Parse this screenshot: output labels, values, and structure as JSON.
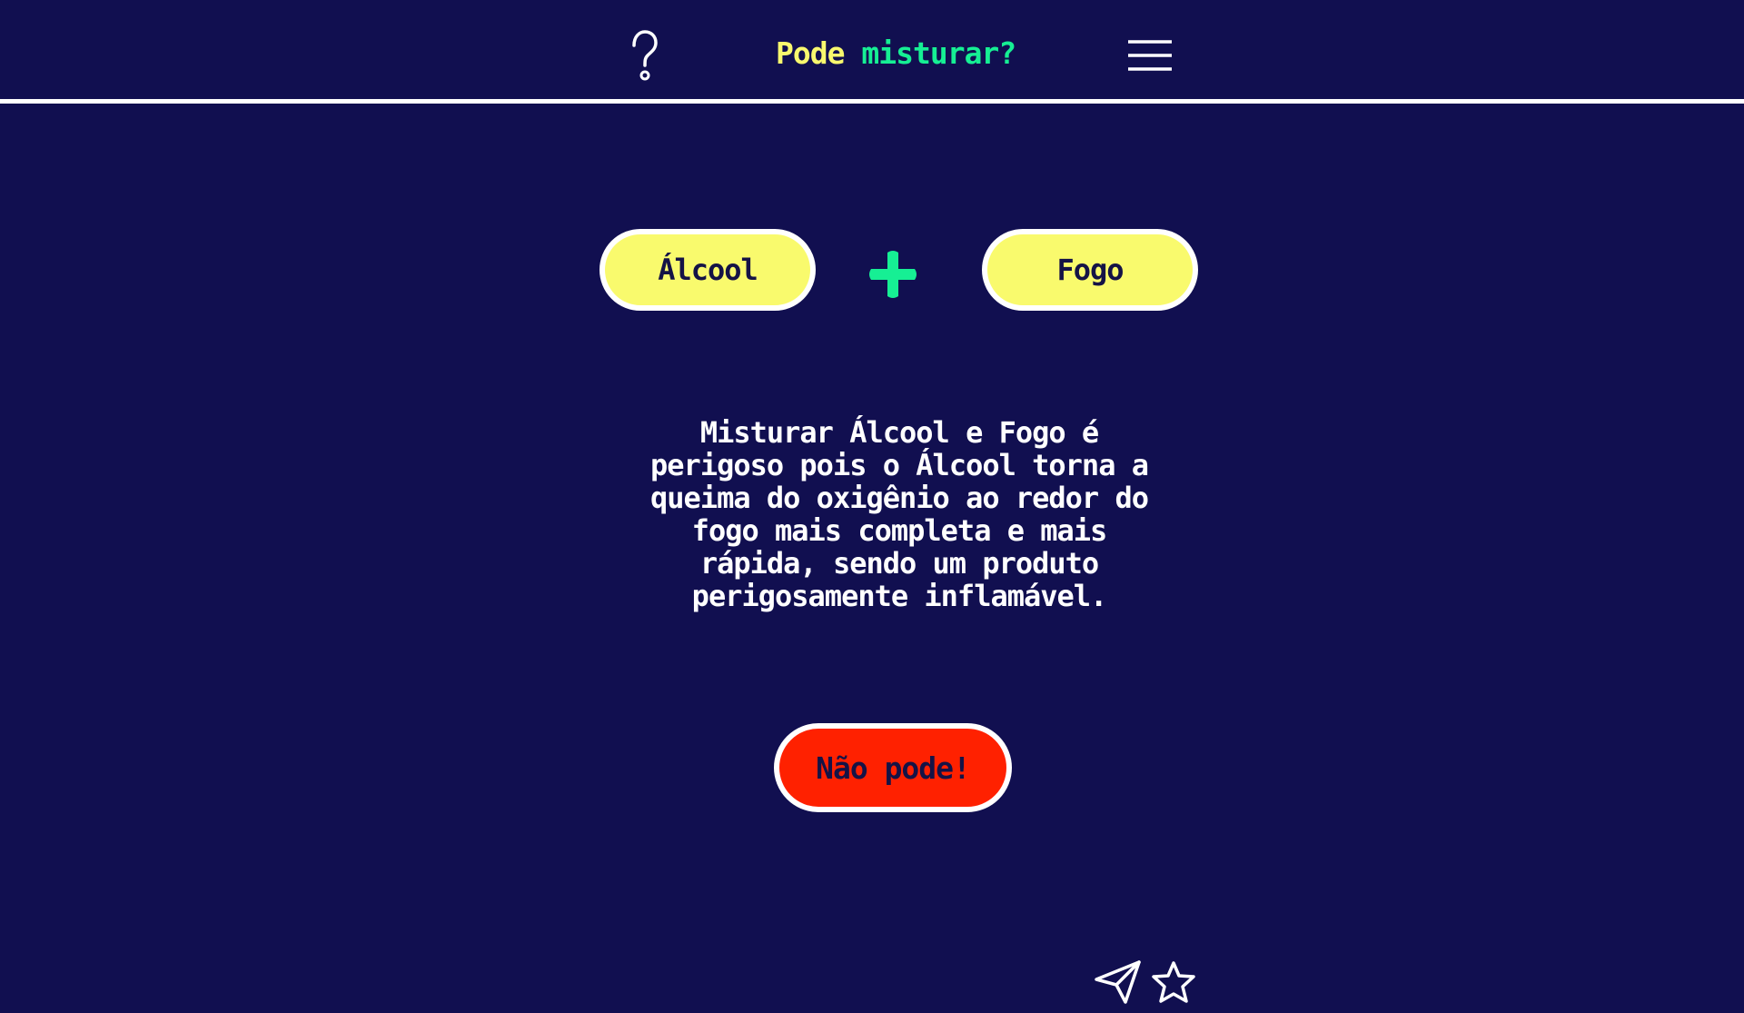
{
  "header": {
    "help_icon": "question-mark-icon",
    "title_part1": "Pode",
    "title_part2": "misturar?",
    "menu_icon": "hamburger-menu-icon"
  },
  "mix": {
    "item1": "Álcool",
    "operator_icon": "plus-icon",
    "item2": "Fogo"
  },
  "description": "Misturar Álcool e Fogo é perigoso pois o Álcool torna a queima do oxigênio ao redor do fogo mais completa e mais rápida, sendo um produto perigosamente inflamável.",
  "verdict": {
    "label": "Não pode!",
    "color": "#ff2100"
  },
  "footer": {
    "share_icon": "paper-plane-icon",
    "favorite_icon": "star-icon"
  },
  "colors": {
    "background": "#110f50",
    "pill_yellow": "#f9fa6d",
    "accent_green": "#16ef94",
    "title_yellow": "#f8f86e",
    "danger_red": "#ff2100"
  }
}
